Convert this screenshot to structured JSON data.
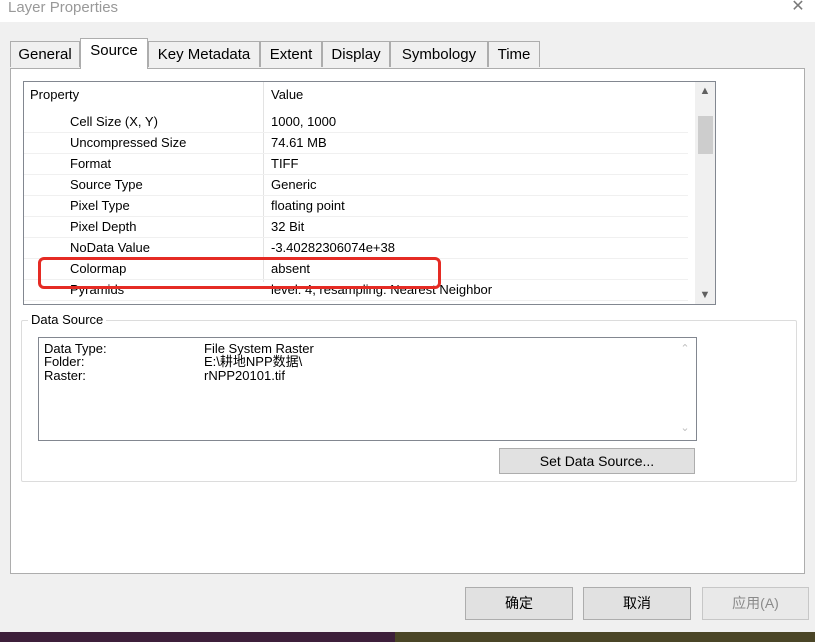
{
  "window": {
    "title": "Layer Properties",
    "close_glyph": "✕"
  },
  "tabs": [
    {
      "label": "General"
    },
    {
      "label": "Source"
    },
    {
      "label": "Key Metadata"
    },
    {
      "label": "Extent"
    },
    {
      "label": "Display"
    },
    {
      "label": "Symbology"
    },
    {
      "label": "Time"
    }
  ],
  "active_tab": "Source",
  "property_table": {
    "headers": {
      "property": "Property",
      "value": "Value"
    },
    "rows": [
      {
        "property": "Cell Size (X, Y)",
        "value": "1000, 1000"
      },
      {
        "property": "Uncompressed Size",
        "value": "74.61 MB"
      },
      {
        "property": "Format",
        "value": "TIFF"
      },
      {
        "property": "Source Type",
        "value": "Generic"
      },
      {
        "property": "Pixel Type",
        "value": "floating point"
      },
      {
        "property": "Pixel Depth",
        "value": "32 Bit"
      },
      {
        "property": "NoData Value",
        "value": "-3.40282306074e+38"
      },
      {
        "property": "Colormap",
        "value": "absent"
      },
      {
        "property": "Pyramids",
        "value": "level: 4, resampling: Nearest Neighbor"
      }
    ],
    "highlighted_row": "Pixel Type"
  },
  "data_source": {
    "legend": "Data Source",
    "lines": [
      {
        "label": "Data Type:",
        "value": "File System Raster"
      },
      {
        "label": "Folder:",
        "value": "E:\\耕地NPP数据\\"
      },
      {
        "label": "Raster:",
        "value": "rNPP20101.tif"
      }
    ],
    "set_button": "Set Data Source..."
  },
  "dialog_buttons": {
    "ok": "确定",
    "cancel": "取消",
    "apply": "应用(A)"
  },
  "colors": {
    "highlight": "#e52b24",
    "title_text": "#999999"
  }
}
